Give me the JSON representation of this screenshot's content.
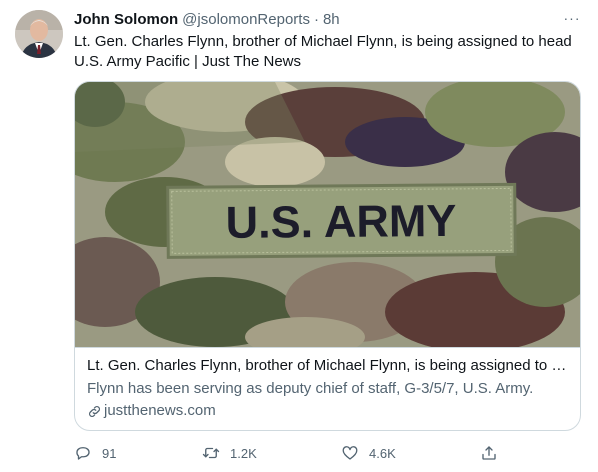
{
  "author": {
    "display_name": "John Solomon",
    "handle": "@jsolomonReports",
    "separator": "·",
    "time": "8h"
  },
  "more_label": "···",
  "tweet": {
    "text": "Lt. Gen. Charles Flynn, brother of Michael Flynn, is being assigned to head U.S. Army Pacific | Just The News"
  },
  "card": {
    "image_patch_text": "U.S. ARMY",
    "title": "Lt. Gen. Charles Flynn, brother of Michael Flynn, is being assigned to he…",
    "description": "Flynn has been serving as deputy chief of staff, G-3/5/7, U.S. Army.",
    "domain": "justthenews.com"
  },
  "actions": {
    "reply_count": "91",
    "retweet_count": "1.2K",
    "like_count": "4.6K"
  },
  "colors": {
    "text": "#0f1419",
    "secondary": "#536471",
    "border": "#cfd9de"
  },
  "icons": [
    "more-icon",
    "link-icon",
    "reply-icon",
    "retweet-icon",
    "like-icon",
    "share-icon"
  ]
}
